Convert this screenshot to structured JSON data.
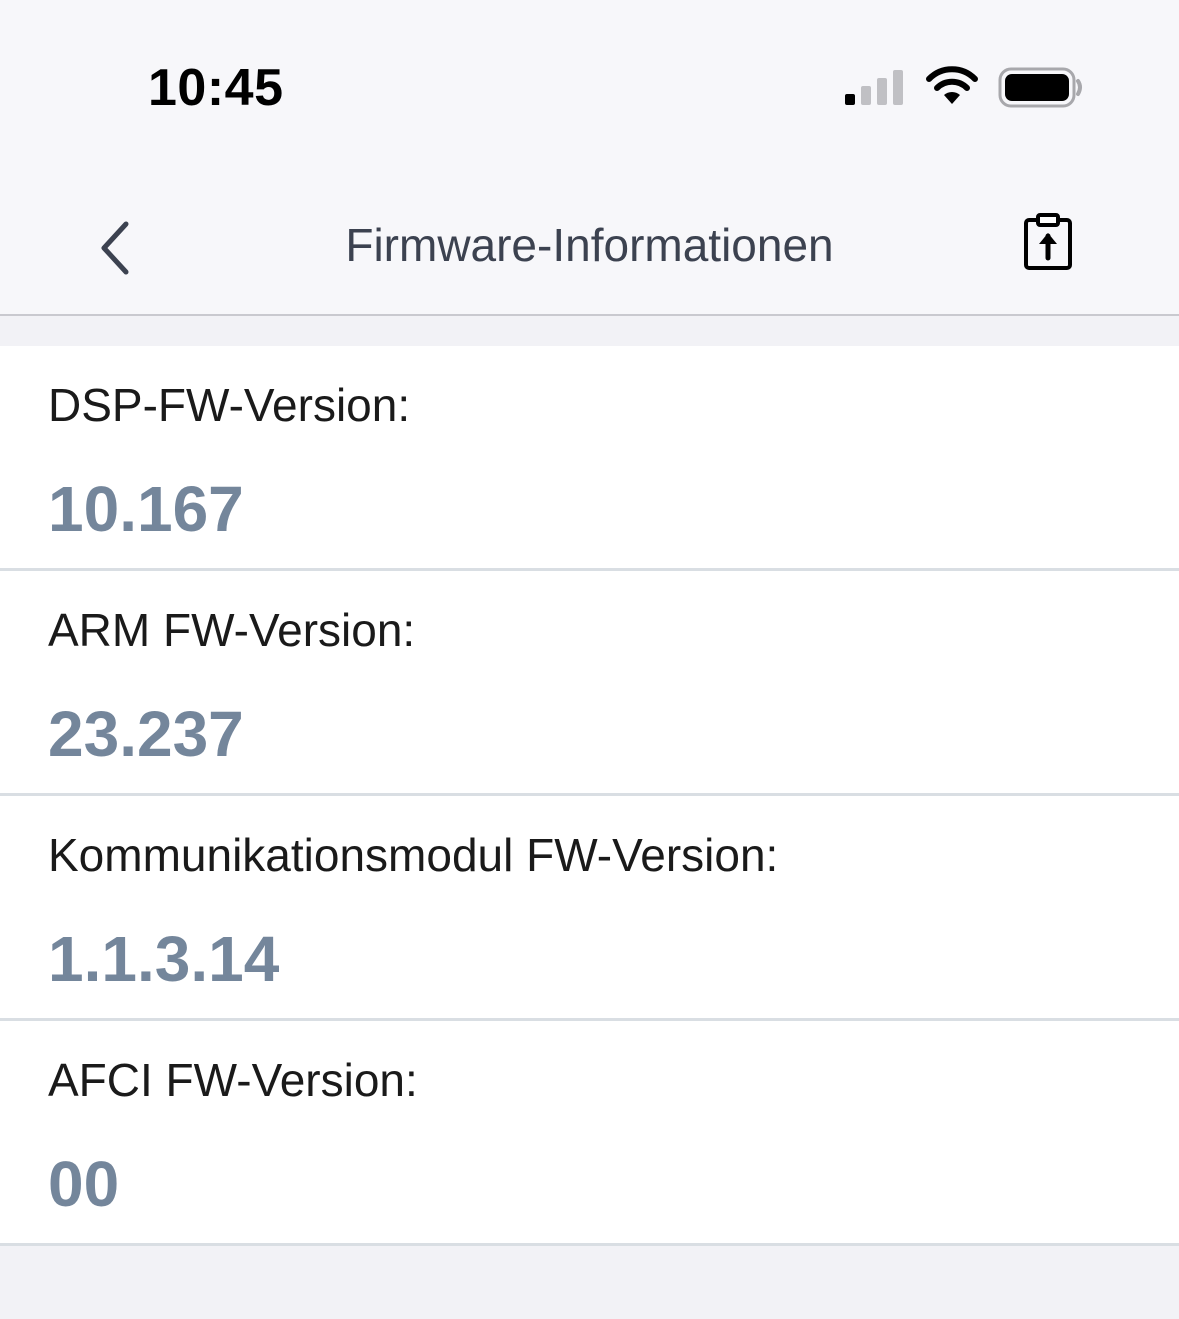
{
  "status_bar": {
    "time": "10:45"
  },
  "nav": {
    "title": "Firmware-Informationen",
    "back_icon": "chevron-left-icon",
    "export_icon": "clipboard-upload-icon"
  },
  "firmware": [
    {
      "label": "DSP-FW-Version:",
      "value": "10.167"
    },
    {
      "label": "ARM FW-Version:",
      "value": "23.237"
    },
    {
      "label": "Kommunikationsmodul FW-Version:",
      "value": "1.1.3.14"
    },
    {
      "label": "AFCI FW-Version:",
      "value": "00"
    }
  ],
  "colors": {
    "value_text": "#74869b",
    "title_text": "#3c4250",
    "background": "#f2f2f6"
  }
}
